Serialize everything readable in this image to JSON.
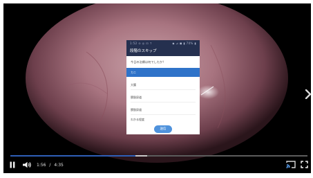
{
  "phone": {
    "status_left": "1:52 ⊙ ◎ ⊡ ↑",
    "status_right": "◆ ⊿ ◼ ▮ 70% ▮",
    "title": "段階のスキップ",
    "question": "今日の治療は何でしたか？",
    "options": [
      {
        "label": "カニ",
        "selected": true
      },
      {
        "label": "大腸",
        "selected": false
      },
      {
        "label": "膀胱尿道",
        "selected": false
      },
      {
        "label": "膀胱尿道",
        "selected": false
      },
      {
        "label": "わかる程度",
        "selected": false
      }
    ],
    "submit_label": "送信"
  },
  "player": {
    "current_time": "1:56",
    "separator": "/",
    "duration": "4:35",
    "progress": 0.422,
    "buffered_end": 0.46
  },
  "colors": {
    "app_bar": "#25304f",
    "selected_option": "#2f73c9",
    "submit_button": "#4f92dc",
    "progress": "#2f5fb8"
  }
}
